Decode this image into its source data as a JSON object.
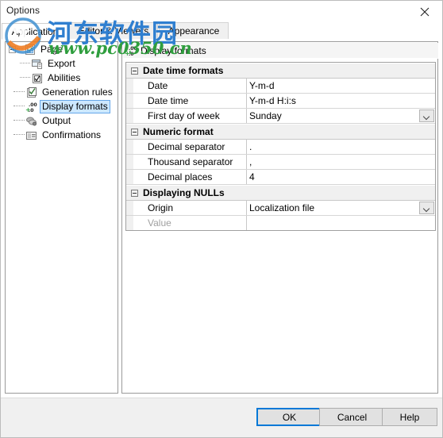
{
  "window": {
    "title": "Options",
    "close_icon": "close-icon"
  },
  "tabs": [
    {
      "label": "Application",
      "accel": "A",
      "selected": true
    },
    {
      "label": "Editor & Viewers",
      "accel": "E",
      "selected": false
    },
    {
      "label": "Appearance",
      "accel": "p",
      "selected": false
    }
  ],
  "tree": [
    {
      "label": "Page",
      "level": 0,
      "expander": "minus",
      "icon": "page-icon",
      "selected": false
    },
    {
      "label": "Export",
      "level": 1,
      "expander": "none",
      "icon": "export-icon",
      "selected": false
    },
    {
      "label": "Abilities",
      "level": 1,
      "expander": "none",
      "icon": "abilities-icon",
      "selected": false
    },
    {
      "label": "Generation rules",
      "level": 0,
      "expander": "none",
      "icon": "generation-rules-icon",
      "selected": false
    },
    {
      "label": "Display formats",
      "level": 0,
      "expander": "none",
      "icon": "display-formats-icon",
      "selected": true
    },
    {
      "label": "Output",
      "level": 0,
      "expander": "none",
      "icon": "output-icon",
      "selected": false
    },
    {
      "label": "Confirmations",
      "level": 0,
      "expander": "none",
      "icon": "confirmations-icon",
      "selected": false
    }
  ],
  "panel": {
    "header_title": "Display formats",
    "header_icon": "display-formats-icon",
    "groups": [
      {
        "title": "Date time formats",
        "expanded": true,
        "rows": [
          {
            "name": "Date",
            "value": "Y-m-d",
            "dropdown": false,
            "disabled": false
          },
          {
            "name": "Date time",
            "value": "Y-m-d H:i:s",
            "dropdown": false,
            "disabled": false
          },
          {
            "name": "First day of week",
            "value": "Sunday",
            "dropdown": true,
            "disabled": false
          }
        ]
      },
      {
        "title": "Numeric format",
        "expanded": true,
        "rows": [
          {
            "name": "Decimal separator",
            "value": ".",
            "dropdown": false,
            "disabled": false
          },
          {
            "name": "Thousand separator",
            "value": ",",
            "dropdown": false,
            "disabled": false
          },
          {
            "name": "Decimal places",
            "value": "4",
            "dropdown": false,
            "disabled": false
          }
        ]
      },
      {
        "title": "Displaying NULLs",
        "expanded": true,
        "rows": [
          {
            "name": "Origin",
            "value": "Localization file",
            "dropdown": true,
            "disabled": false
          },
          {
            "name": "Value",
            "value": "",
            "dropdown": false,
            "disabled": true
          }
        ]
      }
    ]
  },
  "buttons": [
    {
      "label": "OK",
      "accel": "O",
      "default": true
    },
    {
      "label": "Cancel",
      "accel": "",
      "default": false
    },
    {
      "label": "Help",
      "accel": "H",
      "default": false
    }
  ],
  "watermark": {
    "chinese": "河东软件园",
    "url": "www.pc0350.cn",
    "colors": {
      "chinese": "#2f7fd0",
      "url": "#2f9e3e"
    }
  },
  "colors": {
    "accent": "#0078d7",
    "selection": "#cde8ff",
    "group_bg": "#f0f0f0",
    "window_bg": "#ffffff",
    "button_bar_bg": "#f0f0f0"
  }
}
